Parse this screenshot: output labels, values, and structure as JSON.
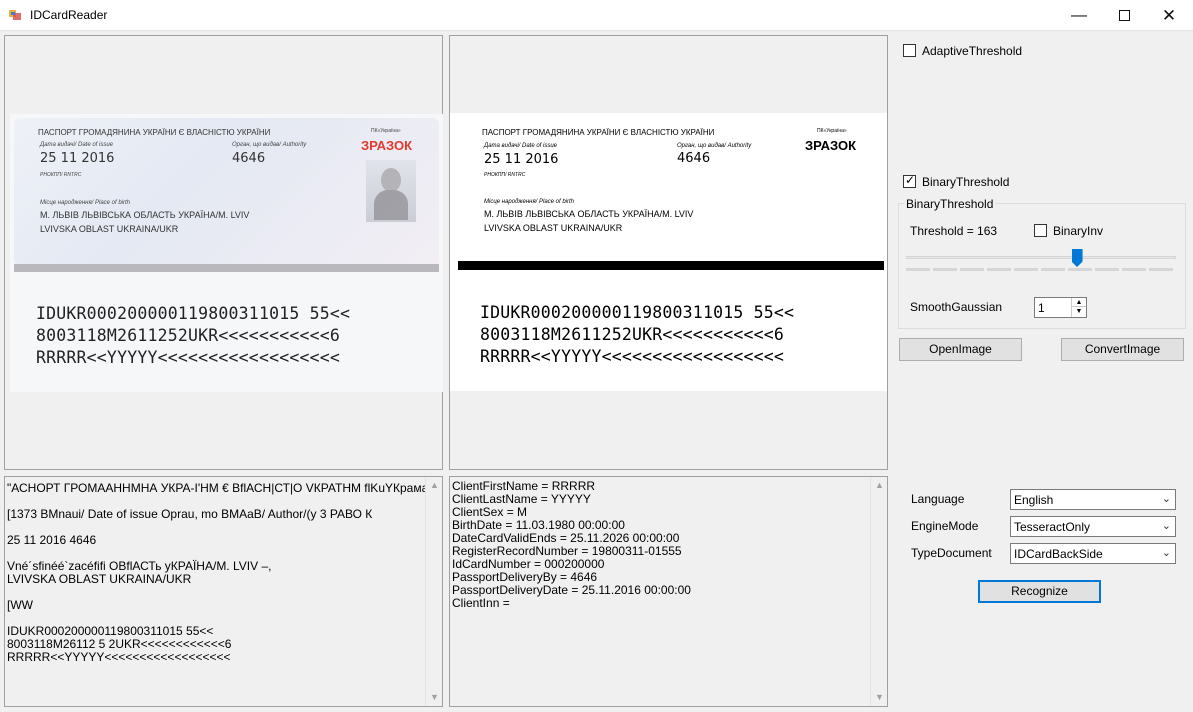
{
  "window": {
    "title": "IDCardReader",
    "minimize_icon": "minimize-icon",
    "maximize_icon": "maximize-icon",
    "close_icon": "close-icon"
  },
  "original_card": {
    "header": "ПАСПОРТ ГРОМАДЯНИНА УКРАЇНИ Є ВЛАСНІСТЮ УКРАЇНИ",
    "small_top": "ПК«Україна»",
    "date_label": "Дата видачі/ Date of issue",
    "authority_label": "Орган, що видав/ Authority",
    "date_value": "25 11 2016",
    "authority_value": "4646",
    "rnokpp": "РНОКПП/ RNTRC",
    "sample": "ЗРАЗОК",
    "place_label": "Місце народження/ Place of birth",
    "place_line1": "М. ЛЬВІВ ЛЬВІВСЬКА ОБЛАСТЬ УКРАЇНА/M. LVIV",
    "place_line2": "LVIVSKA OBLAST UKRAINA/UKR",
    "mrz1": "IDUKR000200000119800311015 55<<",
    "mrz2": "8003118M2611252UKR<<<<<<<<<<<6",
    "mrz3": "RRRRR<<YYYYY<<<<<<<<<<<<<<<<<<"
  },
  "processed_card": {
    "header": "ПАСПОРТ ГРОМАДЯНИНА УКРАЇНИ Є ВЛАСНІСТЮ УКРАЇНИ",
    "small_top": "ПК«Україна»",
    "date_label": "Дата видачі/ Date of issue",
    "authority_label": "Орган, що видав/ Authority",
    "date_value": "25 11 2016",
    "authority_value": "4646",
    "rnokpp": "РНОКПП/ RNTRC",
    "sample": "ЗРАЗОК",
    "place_label": "Місце народження/ Place of birth",
    "place_line1": "М. ЛЬВІВ ЛЬВІВСЬКА ОБЛАСТЬ УКРАЇНА/M. LVIV",
    "place_line2": "LVIVSKA OBLAST UKRAINA/UKR",
    "mrz1": "IDUKR000200000119800311015 55<<",
    "mrz2": "8003118M2611252UKR<<<<<<<<<<<6",
    "mrz3": "RRRRR<<YYYYY<<<<<<<<<<<<<<<<<<"
  },
  "ocr_text": "\"АСНОРТ ГРОМААННМНА УКРА-І'НМ € ВflАСН|СТ|О VКРАТНМ flKuYКрама»\n\n[1373 ВМnaui/ Date of issue Oprau, mo BMAaB/ Author/(y 3 РАВО К\n\n25 11 2016 4646\n\nVné´sfinéé`zacéfifi ОВflАСТь уКРАЇНА/М. LVIV –,\nLVIVSKA OBLAST UKRAINA/UKR\n\n[WW\n\nIDUKR000200000119800311015 55<<\n8003118M26112 5 2UKR<<<<<<<<<<<<6\nRRRRR<<YYYYY<<<<<<<<<<<<<<<<<<",
  "parsed_text": "ClientFirstName = RRRRR\nClientLastName = YYYYY\nClientSex = M\nBirthDate = 11.03.1980 00:00:00\nDateCardValidEnds = 25.11.2026 00:00:00\nRegisterRecordNumber = 19800311-01555\nIdCardNumber = 000200000\nPassportDeliveryBy = 4646\nPassportDeliveryDate = 25.11.2016 00:00:00\nClientInn =",
  "controls": {
    "adaptive_threshold": {
      "label": "AdaptiveThreshold",
      "checked": false
    },
    "binary_threshold": {
      "label": "BinaryThreshold",
      "checked": true
    },
    "group_title": "BinaryThreshold",
    "threshold_label": "Threshold = 163",
    "threshold_value": 163,
    "threshold_max": 255,
    "binary_inv": {
      "label": "BinaryInv",
      "checked": false
    },
    "smooth_label": "SmoothGaussian",
    "smooth_value": "1",
    "open_image": "OpenImage",
    "convert_image": "ConvertImage",
    "language_label": "Language",
    "language_value": "English",
    "engine_label": "EngineMode",
    "engine_value": "TesseractOnly",
    "type_label": "TypeDocument",
    "type_value": "IDCardBackSide",
    "recognize": "Recognize"
  }
}
